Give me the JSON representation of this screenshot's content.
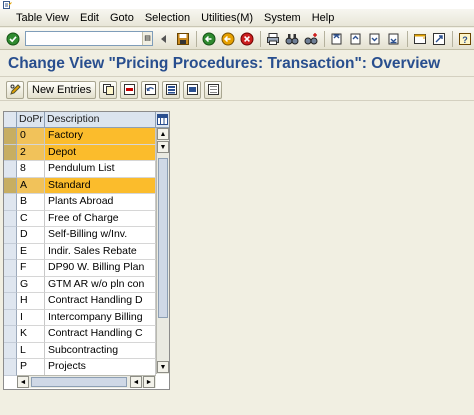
{
  "menu": [
    {
      "label": "Table View",
      "u": "T"
    },
    {
      "label": "Edit",
      "u": "E"
    },
    {
      "label": "Goto",
      "u": "G"
    },
    {
      "label": "Selection",
      "u": "S"
    },
    {
      "label": "Utilities(M)",
      "u": "U"
    },
    {
      "label": "System",
      "u": "y"
    },
    {
      "label": "Help",
      "u": "H"
    }
  ],
  "command_field": {
    "value": ""
  },
  "page_title": "Change View \"Pricing Procedures: Transaction\": Overview",
  "app_toolbar": {
    "new_entries": "New Entries"
  },
  "table": {
    "columns": [
      "DoPr",
      "Description"
    ],
    "rows": [
      {
        "code": "0",
        "desc": "Factory",
        "marked": true
      },
      {
        "code": "2",
        "desc": "Depot",
        "marked": true
      },
      {
        "code": "8",
        "desc": "Pendulum List",
        "marked": false
      },
      {
        "code": "A",
        "desc": "Standard",
        "marked": true
      },
      {
        "code": "B",
        "desc": "Plants Abroad",
        "marked": false
      },
      {
        "code": "C",
        "desc": "Free of Charge",
        "marked": false
      },
      {
        "code": "D",
        "desc": "Self-Billing w/Inv.",
        "marked": false
      },
      {
        "code": "E",
        "desc": "Indir. Sales Rebate",
        "marked": false
      },
      {
        "code": "F",
        "desc": "DP90 W. Billing Plan",
        "marked": false
      },
      {
        "code": "G",
        "desc": "GTM AR w/o pln con",
        "marked": false
      },
      {
        "code": "H",
        "desc": "Contract Handling  D",
        "marked": false
      },
      {
        "code": "I",
        "desc": "Intercompany Billing",
        "marked": false
      },
      {
        "code": "K",
        "desc": "Contract Handling C",
        "marked": false
      },
      {
        "code": "L",
        "desc": "Subcontracting",
        "marked": false
      },
      {
        "code": "P",
        "desc": "Projects",
        "marked": false
      }
    ]
  },
  "colors": {
    "title": "#284e8e",
    "marked_row": "#fbbc2c",
    "background": "#f1efe2"
  }
}
